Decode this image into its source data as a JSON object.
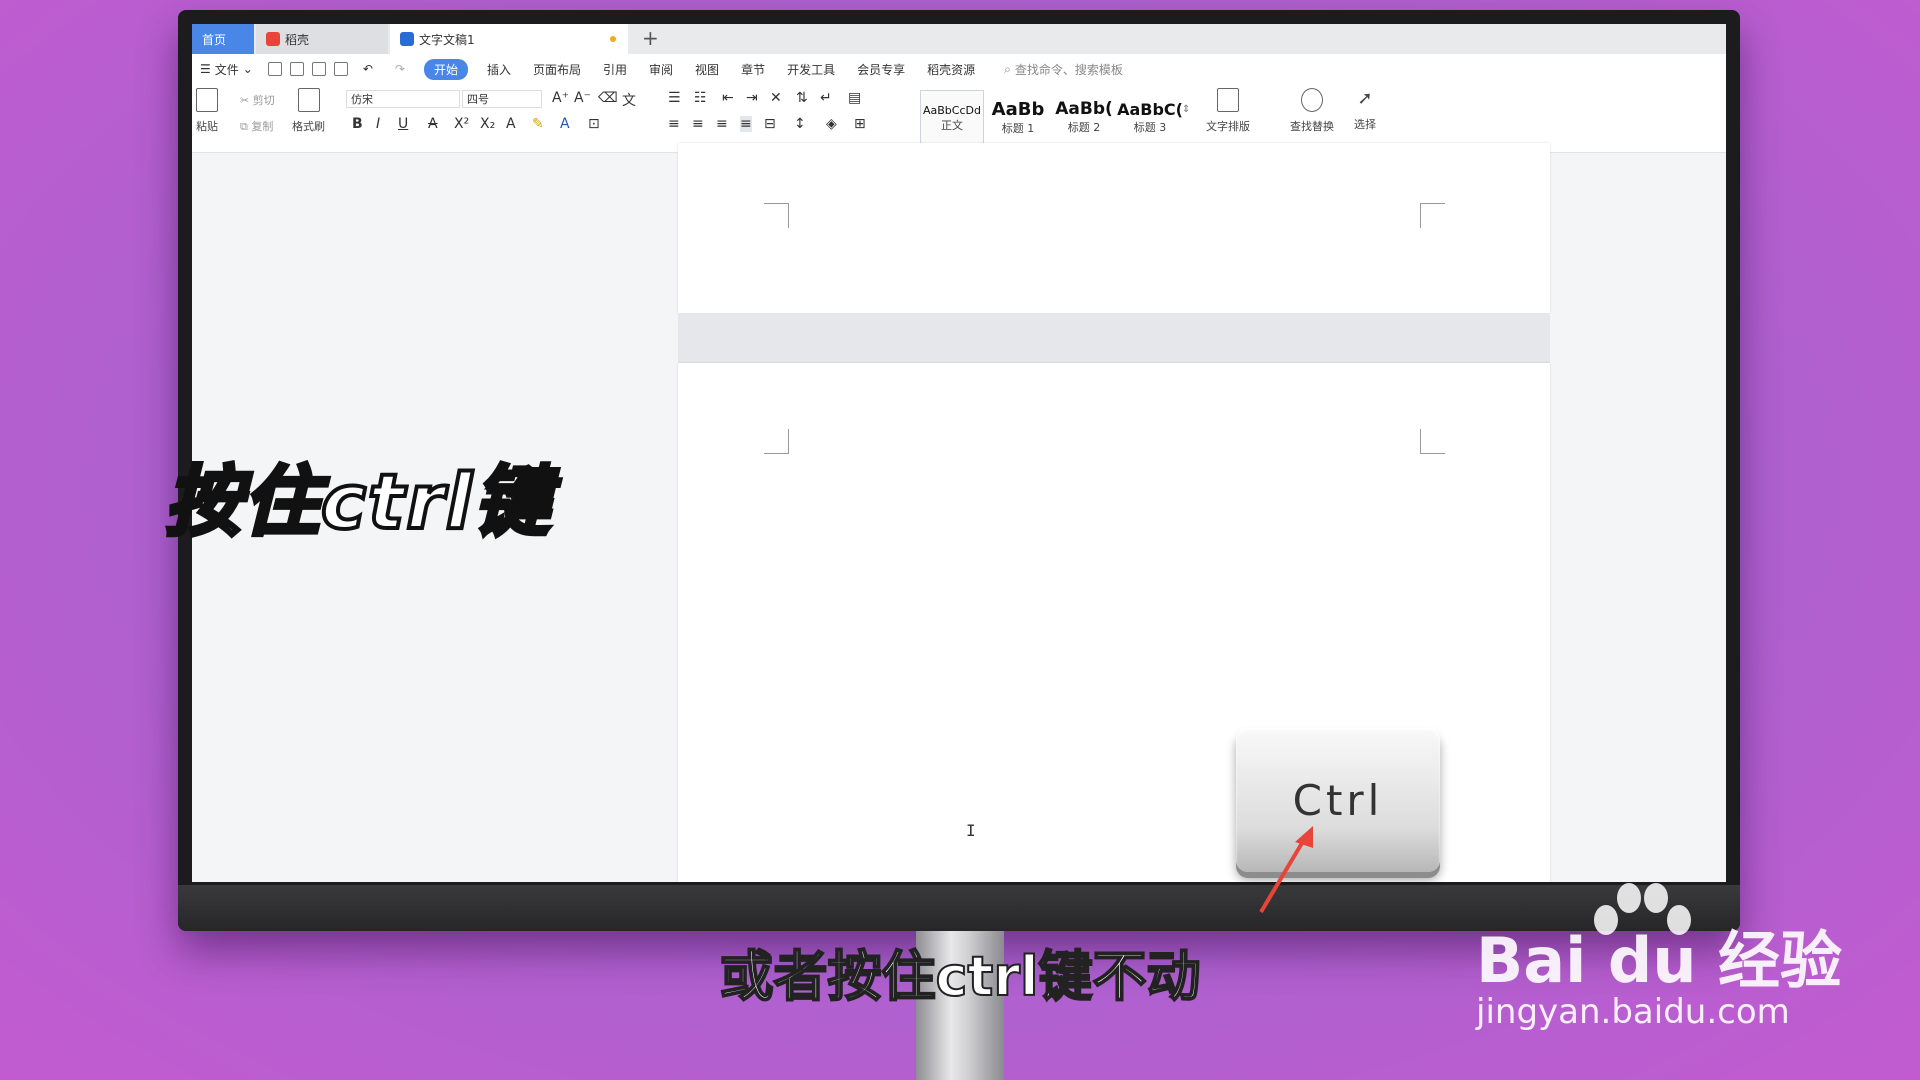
{
  "tabs": {
    "home": "首页",
    "daoke": "稻壳",
    "doc": "文字文稿1",
    "add": "+"
  },
  "menu": {
    "file": "文件",
    "items": [
      "开始",
      "插入",
      "页面布局",
      "引用",
      "审阅",
      "视图",
      "章节",
      "开发工具",
      "会员专享",
      "稻壳资源"
    ],
    "active_index": 0,
    "search": "查找命令、搜索模板"
  },
  "ribbon": {
    "paste": "粘贴",
    "cut": "剪切",
    "copy": "复制",
    "format_painter": "格式刷",
    "font_name": "仿宋",
    "font_size": "四号",
    "styles": [
      {
        "sample": "AaBbCcDd",
        "label": "正文"
      },
      {
        "sample": "AaBb",
        "label": "标题 1"
      },
      {
        "sample": "AaBb(",
        "label": "标题 2"
      },
      {
        "sample": "AaBbC(",
        "label": "标题 3"
      }
    ],
    "text_layout": "文字排版",
    "find_replace": "查找替换",
    "select": "选择"
  },
  "overlay": {
    "big_caption": "按住ctrl键",
    "key_label": "Ctrl",
    "subtitle": "或者按住ctrl键不动"
  },
  "watermark": {
    "logo": "Bai du 经验",
    "url": "jingyan.baidu.com"
  },
  "colors": {
    "accent": "#4a86e8",
    "background_purple": "#a862cf",
    "arrow_red": "#e8443a"
  }
}
